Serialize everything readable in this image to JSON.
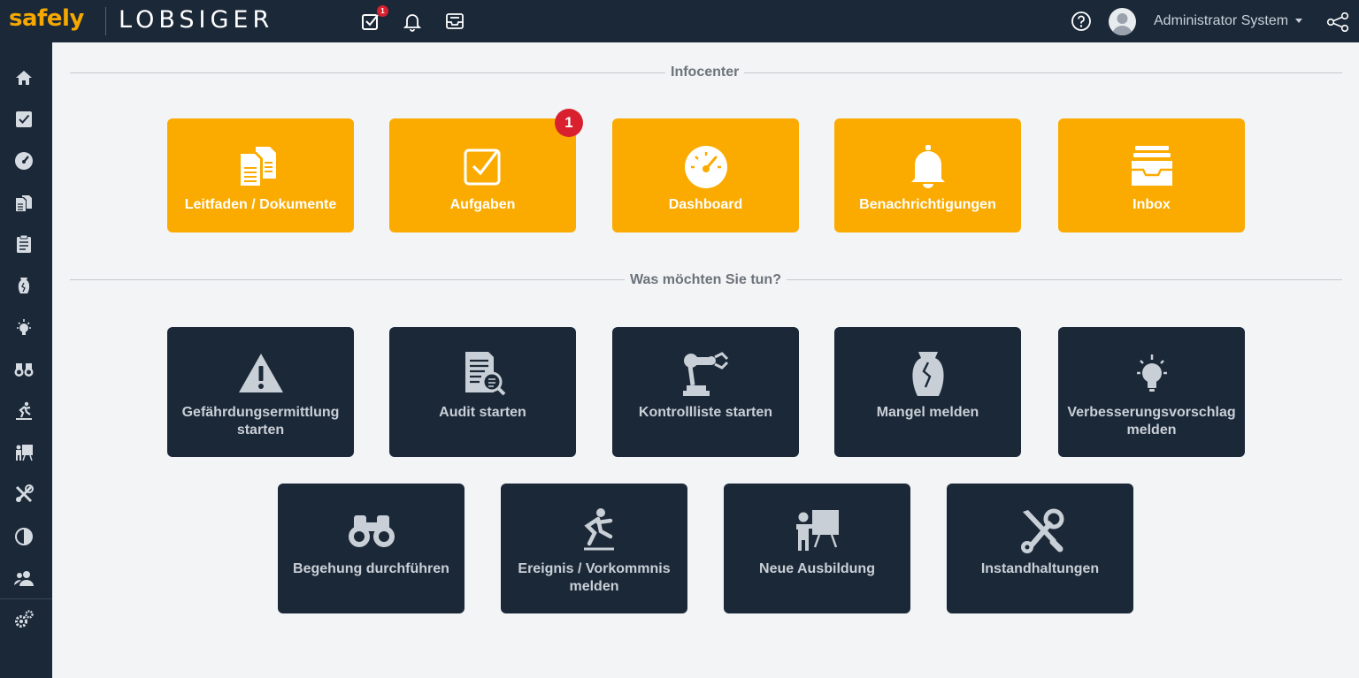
{
  "header": {
    "brand_primary": "safely",
    "brand_secondary": "LOBSIGER",
    "task_badge": "1",
    "user_name": "Administrator System"
  },
  "colors": {
    "topbar": "#1b2838",
    "accent": "#fbab00",
    "dark_tile": "#1b2838",
    "badge": "#d8202f"
  },
  "sidebar": {
    "icons": [
      "home-icon",
      "checkbox-icon",
      "dashboard-icon",
      "documents-icon",
      "clipboard-icon",
      "vase-icon",
      "bulb-icon",
      "binoculars-icon",
      "fall-icon",
      "training-icon",
      "tools-icon",
      "chart-icon",
      "users-icon",
      "settings-icon"
    ]
  },
  "sections": {
    "infocenter_title": "Infocenter",
    "actions_title": "Was möchten Sie tun?"
  },
  "infocenter": {
    "tiles": [
      {
        "label": "Leitfaden / Dokumente",
        "icon": "documents-icon"
      },
      {
        "label": "Aufgaben",
        "icon": "checkbox-icon",
        "badge": "1"
      },
      {
        "label": "Dashboard",
        "icon": "speedometer-icon"
      },
      {
        "label": "Benachrichtigungen",
        "icon": "bell-icon"
      },
      {
        "label": "Inbox",
        "icon": "inbox-icon"
      }
    ]
  },
  "actions": {
    "tiles": [
      {
        "label": "Gefährdungsermittlung starten",
        "icon": "warning-icon"
      },
      {
        "label": "Audit starten",
        "icon": "audit-icon"
      },
      {
        "label": "Kontrollliste starten",
        "icon": "robot-arm-icon"
      },
      {
        "label": "Mangel melden",
        "icon": "broken-vase-icon"
      },
      {
        "label": "Verbesserungsvorschlag melden",
        "icon": "lightbulb-icon"
      },
      {
        "label": "Begehung durchführen",
        "icon": "binoculars-icon"
      },
      {
        "label": "Ereignis / Vorkommnis melden",
        "icon": "fall-icon"
      },
      {
        "label": "Neue Ausbildung",
        "icon": "presentation-icon"
      },
      {
        "label": "Instandhaltungen",
        "icon": "tools-icon"
      }
    ]
  }
}
